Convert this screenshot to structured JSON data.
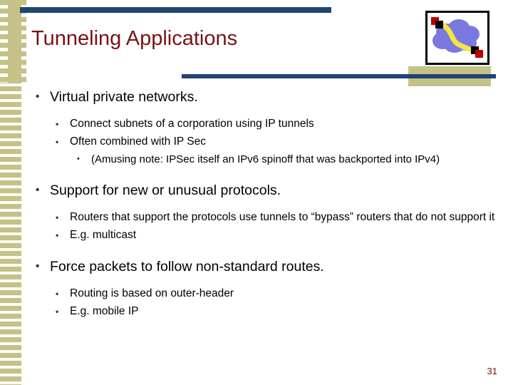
{
  "slide": {
    "title": "Tunneling Applications",
    "page_number": "31",
    "bullet_glyph": "•",
    "colors": {
      "title": "#7a1215",
      "rule": "#1f4571",
      "band": "#c5c189",
      "bullet": "#1f3864",
      "body_text": "#000000",
      "cloud": "#7b78e0",
      "tunnel": "#f5e642",
      "router_red": "#c00000",
      "router_black": "#000000"
    }
  },
  "icon": {
    "name": "network-tunnel-diagram",
    "description": "Cloud with a yellow tunnel passing through between two routers"
  },
  "content": {
    "sections": [
      {
        "heading": "Virtual private networks.",
        "subs": [
          {
            "text": "Connect subnets of a corporation using IP tunnels",
            "subs": []
          },
          {
            "text": "Often combined with IP Sec",
            "subs": [
              {
                "text": "(Amusing note:  IPSec itself an IPv6 spinoff that was backported into IPv4)"
              }
            ]
          }
        ]
      },
      {
        "heading": "Support for new or unusual protocols.",
        "subs": [
          {
            "text": "Routers that support the protocols use tunnels to “bypass” routers that do not support it",
            "subs": []
          },
          {
            "text": "E.g. multicast",
            "subs": []
          }
        ]
      },
      {
        "heading": "Force packets to follow non-standard routes.",
        "subs": [
          {
            "text": "Routing is based on outer-header",
            "subs": []
          },
          {
            "text": "E.g. mobile IP",
            "subs": []
          }
        ]
      }
    ]
  }
}
